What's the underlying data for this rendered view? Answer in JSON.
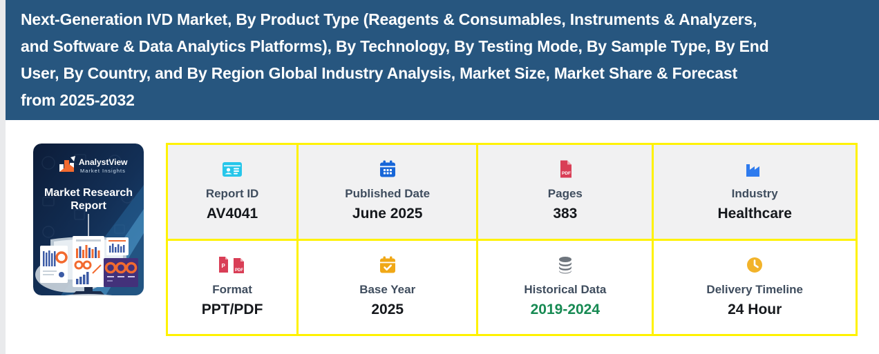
{
  "header": {
    "background_color": "#27567f",
    "text_color": "#ffffff",
    "title": "Next-Generation IVD Market, By Product Type (Reagents & Consumables, Instruments & Analyzers, and Software & Data Analytics Platforms), By Technology, By Testing Mode, By Sample Type, By End User, By Country, and By Region Global Industry Analysis, Market Size, Market Share & Forecast from 2025-2032",
    "title_lines": [
      "Next-Generation IVD Market, By Product Type (Reagents & Consumables, Instruments & Analyzers,",
      "and Software & Data Analytics Platforms), By Technology, By Testing Mode, By Sample Type, By End",
      "User, By Country, and By Region Global Industry Analysis, Market Size, Market Share & Forecast",
      "from 2025-2032"
    ]
  },
  "cover": {
    "brand": "AnalystView",
    "brand_sub": "Market Insights",
    "title_line1": "Market Research",
    "title_line2": "Report"
  },
  "grid": {
    "border_color": "#fff200",
    "shaded_row_background": "#f1f1f2",
    "cells": [
      {
        "label": "Report ID",
        "value": "AV4041",
        "icon": "id-card-icon",
        "icon_color": "#26c6ea",
        "value_color": "#15181c"
      },
      {
        "label": "Published Date",
        "value": "June 2025",
        "icon": "calendar-icon",
        "icon_color": "#1766d8",
        "value_color": "#15181c"
      },
      {
        "label": "Pages",
        "value": "383",
        "icon": "pdf-file-icon",
        "icon_color": "#d93e56",
        "value_color": "#15181c"
      },
      {
        "label": "Industry",
        "value": "Healthcare",
        "icon": "factory-icon",
        "icon_color": "#2e7bee",
        "value_color": "#15181c"
      },
      {
        "label": "Format",
        "value": "PPT/PDF",
        "icon": "ppt-pdf-files-icon",
        "icon_color": "#d93e56",
        "value_color": "#15181c"
      },
      {
        "label": "Base Year",
        "value": "2025",
        "icon": "calendar-check-icon",
        "icon_color": "#f0a817",
        "value_color": "#15181c"
      },
      {
        "label": "Historical Data",
        "value": "2019-2024",
        "icon": "database-icon",
        "icon_color": "#6e757d",
        "value_color": "#178a53"
      },
      {
        "label": "Delivery Timeline",
        "value": "24 Hour",
        "icon": "clock-icon",
        "icon_color": "#f2b32a",
        "value_color": "#15181c"
      }
    ]
  }
}
